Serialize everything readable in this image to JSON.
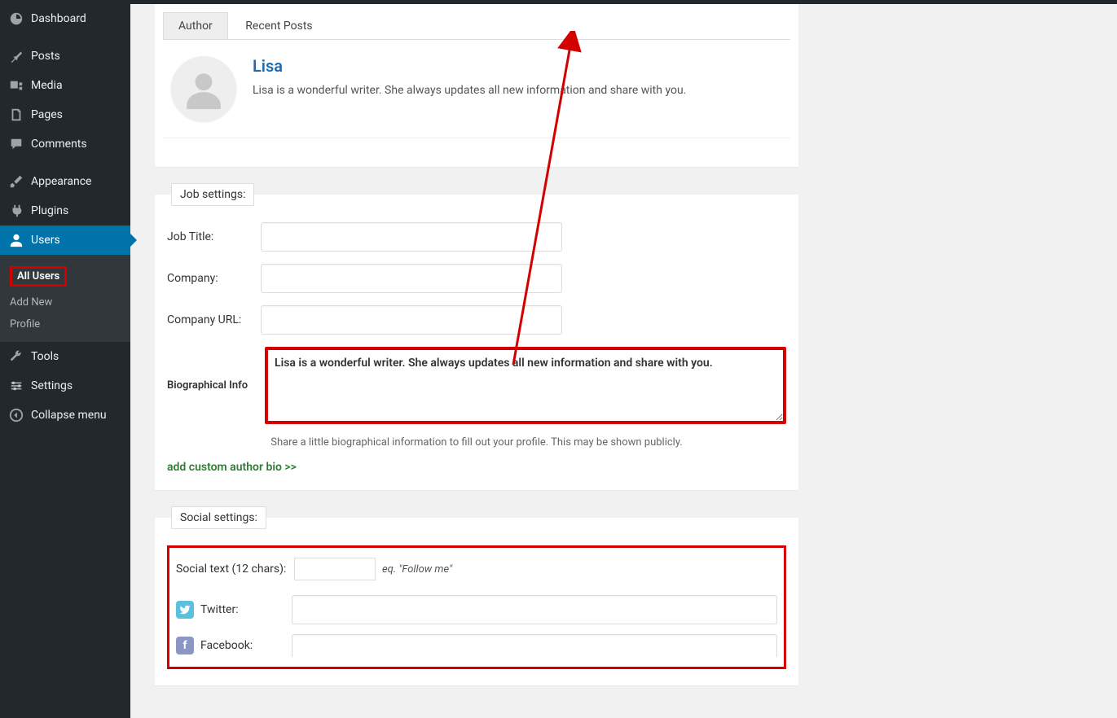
{
  "sidebar": {
    "dashboard": "Dashboard",
    "posts": "Posts",
    "media": "Media",
    "pages": "Pages",
    "comments": "Comments",
    "appearance": "Appearance",
    "plugins": "Plugins",
    "users": "Users",
    "tools": "Tools",
    "settings": "Settings",
    "collapse": "Collapse menu",
    "submenu": {
      "all_users": "All Users",
      "add_new": "Add New",
      "profile": "Profile"
    }
  },
  "author_box": {
    "tab_author": "Author",
    "tab_recent": "Recent Posts",
    "name": "Lisa",
    "bio": "Lisa is a wonderful writer. She always updates all new information and share with you."
  },
  "job_settings": {
    "legend": "Job settings:",
    "job_title_label": "Job Title:",
    "job_title_value": "",
    "company_label": "Company:",
    "company_value": "",
    "company_url_label": "Company URL:",
    "company_url_value": "",
    "bio_label": "Biographical Info",
    "bio_value": "Lisa is a wonderful writer. She always updates all new information and share with you.",
    "bio_help": "Share a little biographical information to fill out your profile. This may be shown publicly.",
    "custom_link": "add custom author bio >>"
  },
  "social_settings": {
    "legend": "Social settings:",
    "text_label": "Social text (12 chars):",
    "text_value": "",
    "text_hint": "eq. \"Follow me\"",
    "twitter_label": "Twitter:",
    "twitter_value": "",
    "facebook_label": "Facebook:",
    "facebook_value": ""
  }
}
